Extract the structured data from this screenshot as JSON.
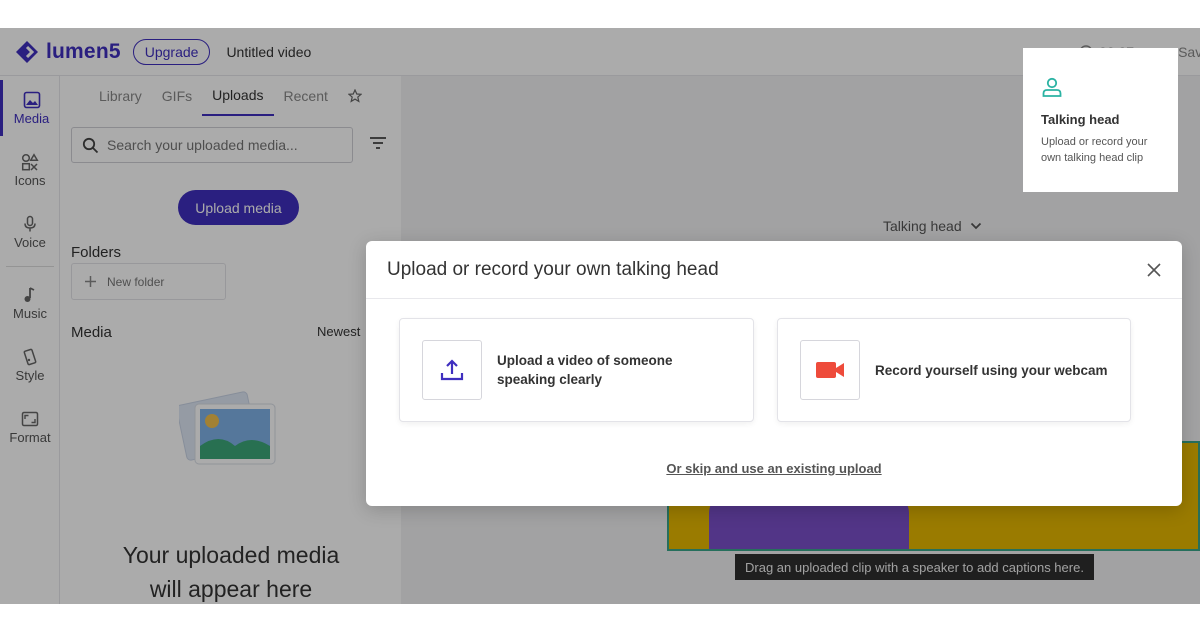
{
  "brand": {
    "name": "lumen5",
    "accent": "#3f2fbf"
  },
  "header": {
    "upgrade_label": "Upgrade",
    "video_title": "Untitled video",
    "timer": "00:07",
    "save_label": "Save"
  },
  "rail": {
    "items": [
      {
        "label": "Media",
        "icon": "image-icon",
        "active": true
      },
      {
        "label": "Icons",
        "icon": "shapes-icon"
      },
      {
        "label": "Voice",
        "icon": "microphone-icon"
      },
      {
        "label": "Music",
        "icon": "music-note-icon"
      },
      {
        "label": "Style",
        "icon": "style-icon"
      },
      {
        "label": "Format",
        "icon": "format-icon"
      }
    ]
  },
  "panel": {
    "tabs": [
      {
        "label": "Library"
      },
      {
        "label": "GIFs"
      },
      {
        "label": "Uploads",
        "active": true
      },
      {
        "label": "Recent"
      }
    ],
    "search_placeholder": "Search your uploaded media...",
    "upload_button": "Upload media",
    "folders_label": "Folders",
    "new_folder_label": "New folder",
    "media_label": "Media",
    "sort_label": "Newest",
    "empty_text_line1": "Your uploaded media",
    "empty_text_line2": "will appear here"
  },
  "canvas": {
    "talking_head_dropdown": "Talking head",
    "caption_hint": "Drag an uploaded clip with a speaker to add captions here."
  },
  "talking_head_card": {
    "title": "Talking head",
    "description": "Upload or record your own talking head clip"
  },
  "modal": {
    "title": "Upload or record your own talking head",
    "options": [
      {
        "label": "Upload a video of someone speaking clearly",
        "icon": "upload-icon"
      },
      {
        "label": "Record yourself using your webcam",
        "icon": "video-camera-icon"
      }
    ],
    "skip_link": "Or skip and use an existing upload"
  }
}
